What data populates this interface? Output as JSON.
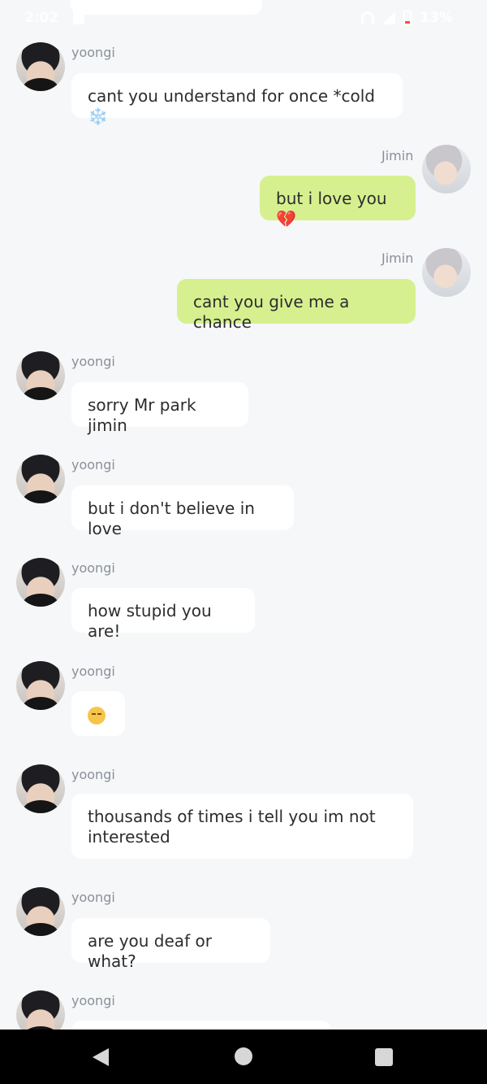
{
  "status_bar": {
    "time": "2:02",
    "battery": "13%"
  },
  "messages": [
    {
      "sender": "yoongi",
      "text": "cant you understand for once *cold",
      "emoji": "❄️"
    },
    {
      "sender": "Jimin",
      "text": "but i love you",
      "emoji": "💔"
    },
    {
      "sender": "Jimin",
      "text": "cant you give me a chance"
    },
    {
      "sender": "yoongi",
      "text": "sorry Mr park jimin"
    },
    {
      "sender": "yoongi",
      "text": "but i don't believe in love"
    },
    {
      "sender": "yoongi",
      "text": "how stupid you are!"
    },
    {
      "sender": "yoongi",
      "emoji": "😞"
    },
    {
      "sender": "yoongi",
      "text": "thousands of times i tell you im not interested"
    },
    {
      "sender": "yoongi",
      "text": "are you deaf or what?"
    },
    {
      "sender": "yoongi"
    }
  ],
  "icons": {
    "nav_back": "back-triangle-icon",
    "nav_home": "home-circle-icon",
    "nav_recent": "recent-apps-square-icon"
  },
  "colors": {
    "background": "#f6f7f9",
    "incoming_bubble": "#ffffff",
    "outgoing_bubble": "#d6f08f",
    "sender_name": "#8a8f98",
    "nav_bar": "#000000"
  }
}
